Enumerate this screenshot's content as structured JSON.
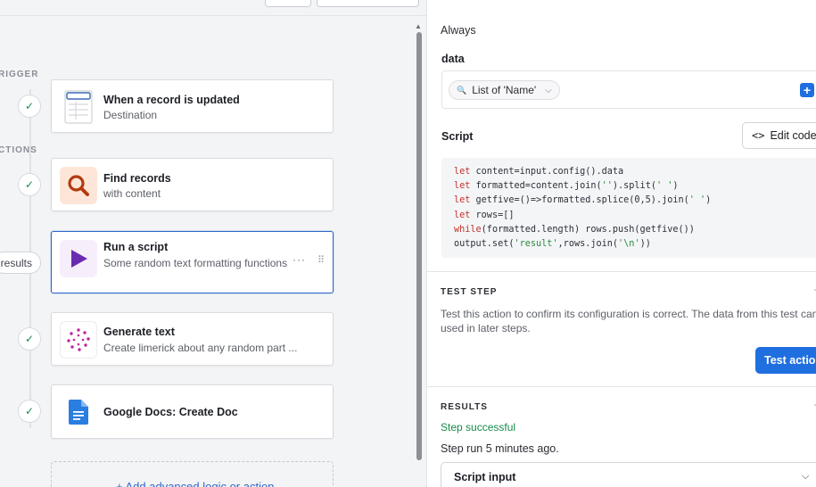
{
  "canvas": {
    "section_trigger": "RIGGER",
    "section_actions": "CTIONS",
    "results_pill": "results",
    "cards": [
      {
        "title": "When a record is updated",
        "subtitle": "Destination"
      },
      {
        "title": "Find records",
        "subtitle": "with content"
      },
      {
        "title": "Run a script",
        "subtitle": "Some random text formatting functions",
        "more": "···",
        "drag": "⠿"
      },
      {
        "title": "Generate text",
        "subtitle": "Create limerick about any random part ..."
      },
      {
        "title": "Google Docs: Create Doc",
        "subtitle": ""
      }
    ],
    "add_link": "+ Add advanced logic or action"
  },
  "panel": {
    "always": "Always",
    "data_label": "data",
    "data_token": "List of 'Name'",
    "script_label": "Script",
    "edit_code": "Edit code",
    "code_lines": [
      "let content=input.config().data",
      "let formatted=content.join('').split(' ')",
      "let getfive=()=>formatted.splice(0,5).join(' ')",
      "let rows=[]",
      "while(formatted.length) rows.push(getfive())",
      "output.set('result',rows.join('\\n'))"
    ],
    "test_step_title": "TEST STEP",
    "test_step_desc": "Test this action to confirm its configuration is correct. The data from this test can be used in later steps.",
    "test_button": "Test action",
    "results_title": "RESULTS",
    "step_success": "Step successful",
    "step_run": "Step run 5 minutes ago.",
    "script_input": "Script input"
  },
  "colors": {
    "accent": "#1f6fe0",
    "success": "#188a4a",
    "selected_border": "#2d67c8"
  },
  "icons": [
    "check-icon",
    "table-icon",
    "search-icon",
    "play-icon",
    "sparkle-icon",
    "google-docs-icon",
    "code-icon",
    "plus-icon",
    "chevron-down-icon"
  ]
}
